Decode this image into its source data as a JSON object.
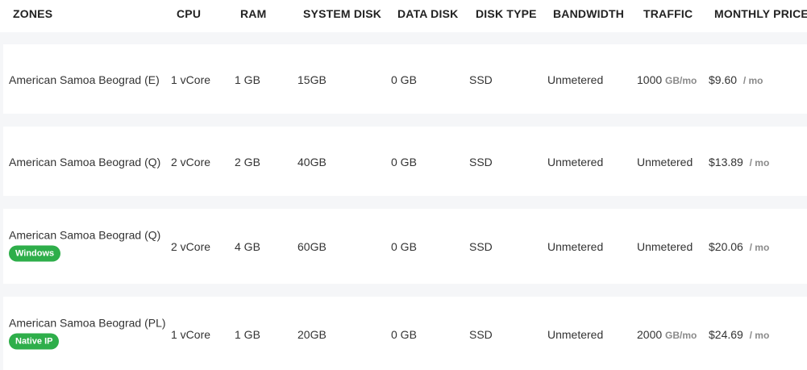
{
  "headers": {
    "zones": "ZONES",
    "cpu": "CPU",
    "ram": "RAM",
    "system_disk": "SYSTEM DISK",
    "data_disk": "DATA DISK",
    "disk_type": "DISK TYPE",
    "bandwidth": "BANDWIDTH",
    "traffic": "TRAFFIC",
    "monthly_price": "MONTHLY PRICE"
  },
  "rows": [
    {
      "zone": "American Samoa Beograd (E)",
      "badge": "",
      "cpu": "1 vCore",
      "ram": "1 GB",
      "system_disk": "15GB",
      "data_disk": "0 GB",
      "disk_type": "SSD",
      "bandwidth": "Unmetered",
      "traffic": "1000",
      "traffic_unit": "GB/mo",
      "price": "$9.60",
      "price_unit": "/ mo"
    },
    {
      "zone": "American Samoa Beograd (Q)",
      "badge": "",
      "cpu": "2 vCore",
      "ram": "2 GB",
      "system_disk": "40GB",
      "data_disk": "0 GB",
      "disk_type": "SSD",
      "bandwidth": "Unmetered",
      "traffic": "Unmetered",
      "traffic_unit": "",
      "price": "$13.89",
      "price_unit": "/ mo"
    },
    {
      "zone": "American Samoa Beograd (Q)",
      "badge": "Windows",
      "cpu": "2 vCore",
      "ram": "4 GB",
      "system_disk": "60GB",
      "data_disk": "0 GB",
      "disk_type": "SSD",
      "bandwidth": "Unmetered",
      "traffic": "Unmetered",
      "traffic_unit": "",
      "price": "$20.06",
      "price_unit": "/ mo"
    },
    {
      "zone": "American Samoa Beograd (PL)",
      "badge": "Native IP",
      "cpu": "1 vCore",
      "ram": "1 GB",
      "system_disk": "20GB",
      "data_disk": "0 GB",
      "disk_type": "SSD",
      "bandwidth": "Unmetered",
      "traffic": "2000",
      "traffic_unit": "GB/mo",
      "price": "$24.69",
      "price_unit": "/ mo"
    }
  ],
  "colors": {
    "badge_green": "#2eae4a",
    "unit_gray": "#8a8a8a",
    "page_background": "#f5f6f8",
    "row_background": "#ffffff"
  }
}
